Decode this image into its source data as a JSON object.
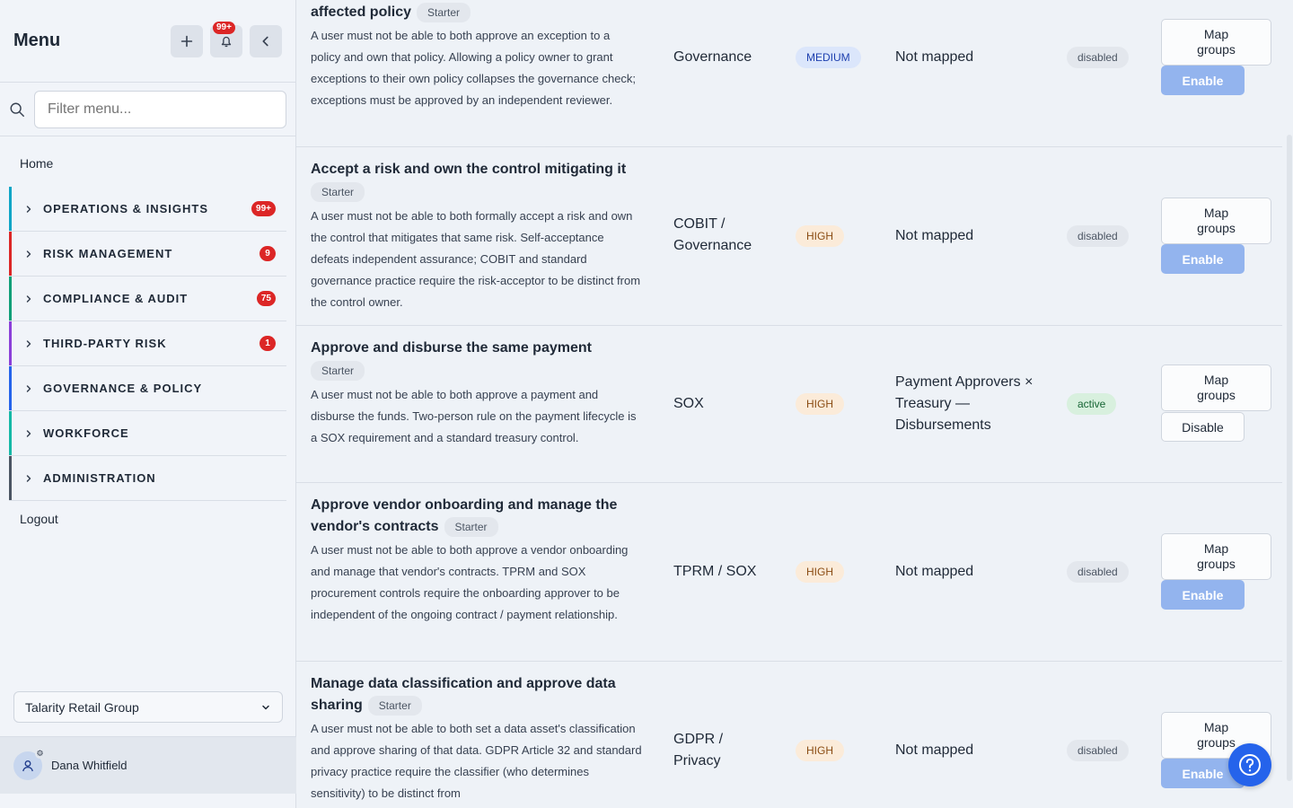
{
  "sidebar": {
    "title": "Menu",
    "notif_badge": "99+",
    "search": {
      "placeholder": "Filter menu..."
    },
    "home": "Home",
    "sections": [
      {
        "label": "OPERATIONS & INSIGHTS",
        "count": "99+",
        "color": "#0ea5c6"
      },
      {
        "label": "RISK MANAGEMENT",
        "count": "9",
        "color": "#dc2626"
      },
      {
        "label": "COMPLIANCE & AUDIT",
        "count": "75",
        "color": "#0f9f78"
      },
      {
        "label": "THIRD-PARTY RISK",
        "count": "1",
        "color": "#8b3fd9"
      },
      {
        "label": "GOVERNANCE & POLICY",
        "count": "",
        "color": "#2563eb"
      },
      {
        "label": "WORKFORCE",
        "count": "",
        "color": "#14b8a6"
      },
      {
        "label": "ADMINISTRATION",
        "count": "",
        "color": "#4b5563"
      }
    ],
    "logout": "Logout",
    "org": "Talarity Retail Group",
    "user": "Dana Whitfield"
  },
  "rows": [
    {
      "title": "affected policy",
      "tag": "Starter",
      "desc": "A user must not be able to both approve an exception to a policy and own that policy. Allowing a policy owner to grant exceptions to their own policy collapses the governance check; exceptions must be approved by an independent reviewer.",
      "framework": "Governance",
      "severity": "MEDIUM",
      "mapping": "Not mapped",
      "status": "disabled",
      "map_label": "Map groups",
      "action": "Enable"
    },
    {
      "title": "Accept a risk and own the control mitigating it",
      "tag": "Starter",
      "desc": "A user must not be able to both formally accept a risk and own the control that mitigates that same risk. Self-acceptance defeats independent assurance; COBIT and standard governance practice require the risk-acceptor to be distinct from the control owner.",
      "framework": "COBIT / Governance",
      "severity": "HIGH",
      "mapping": "Not mapped",
      "status": "disabled",
      "map_label": "Map groups",
      "action": "Enable"
    },
    {
      "title": "Approve and disburse the same payment",
      "tag": "Starter",
      "desc": "A user must not be able to both approve a payment and disburse the funds. Two-person rule on the payment lifecycle is a SOX requirement and a standard treasury control.",
      "framework": "SOX",
      "severity": "HIGH",
      "mapping": "Payment Approvers × Treasury — Disbursements",
      "status": "active",
      "map_label": "Map groups",
      "action": "Disable"
    },
    {
      "title": "Approve vendor onboarding and manage the vendor's contracts",
      "tag": "Starter",
      "desc": "A user must not be able to both approve a vendor onboarding and manage that vendor's contracts. TPRM and SOX procurement controls require the onboarding approver to be independent of the ongoing contract / payment relationship.",
      "framework": "TPRM / SOX",
      "severity": "HIGH",
      "mapping": "Not mapped",
      "status": "disabled",
      "map_label": "Map groups",
      "action": "Enable"
    },
    {
      "title": "Manage data classification and approve data sharing",
      "tag": "Starter",
      "desc": "A user must not be able to both set a data asset's classification and approve sharing of that data. GDPR Article 32 and standard privacy practice require the classifier (who determines sensitivity) to be distinct from",
      "framework": "GDPR / Privacy",
      "severity": "HIGH",
      "mapping": "Not mapped",
      "status": "disabled",
      "map_label": "Map groups",
      "action": "Enable"
    }
  ]
}
